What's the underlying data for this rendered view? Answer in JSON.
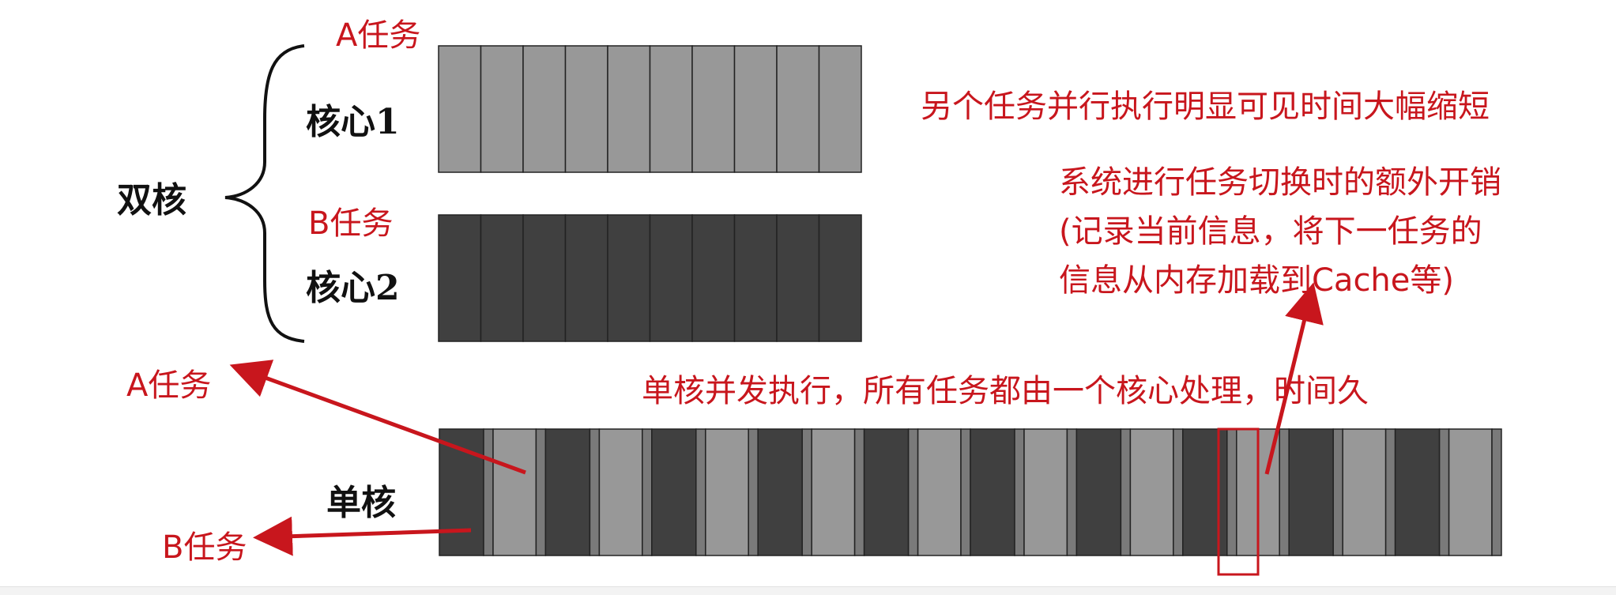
{
  "labels": {
    "dual_core": "双核",
    "core1": "核心1",
    "core2": "核心2",
    "single_core": "单核",
    "task_a_top": "A任务",
    "task_b_mid": "B任务",
    "task_a_arrow": "A任务",
    "task_b_arrow": "B任务",
    "parallel_note": "另个任务并行执行明显可见时间大幅缩短",
    "switch_note": [
      "系统进行任务切换时的额外开销",
      "(记录当前信息，将下一任务的",
      "信息从内存加载到Cache等)"
    ],
    "concurrent_note": "单核并发执行，所有任务都由一个核心处理，时间久"
  },
  "colors": {
    "task_a": "#989898",
    "task_b": "#404040",
    "switch_gap": "#7a7a7a",
    "annotation": "#c8161d",
    "stroke": "#222222"
  },
  "timeline": {
    "core1_slots": 10,
    "core2_slots": 10,
    "single_core_pairs": 10
  }
}
